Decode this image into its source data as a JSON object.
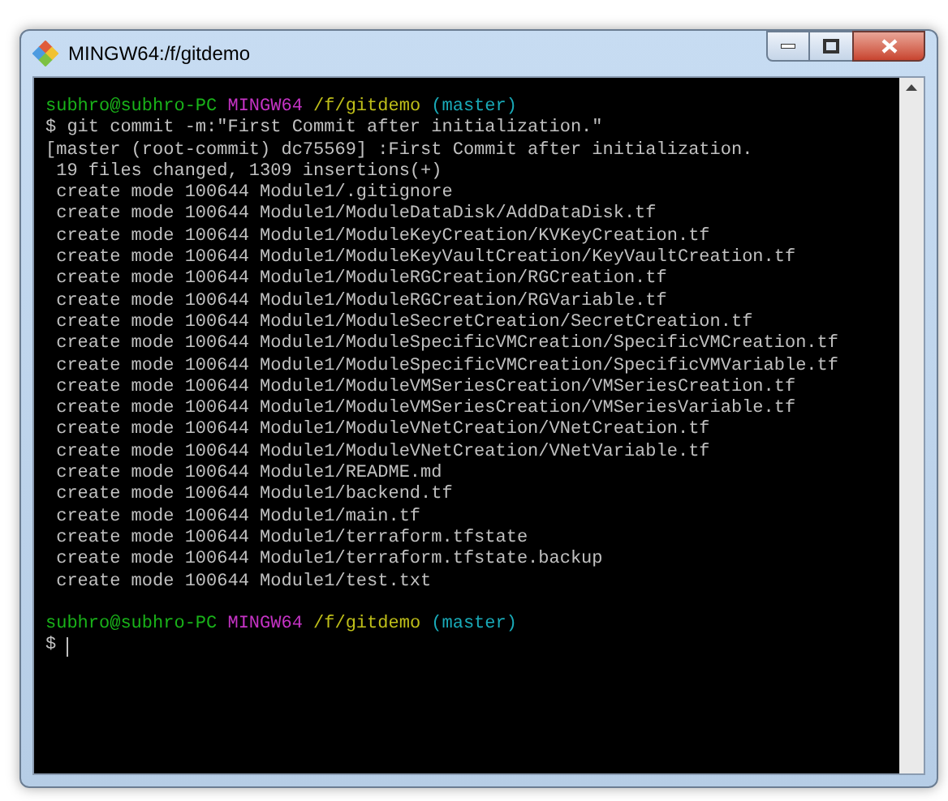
{
  "window": {
    "title": "MINGW64:/f/gitdemo"
  },
  "terminal": {
    "lines": [
      {
        "kind": "prompt",
        "user": "subhro@subhro-PC",
        "system": "MINGW64",
        "path": "/f/gitdemo",
        "branch": "(master)"
      },
      {
        "kind": "text",
        "text": "$ git commit -m:\"First Commit after initialization.\""
      },
      {
        "kind": "text",
        "text": "[master (root-commit) dc75569] :First Commit after initialization."
      },
      {
        "kind": "text",
        "text": " 19 files changed, 1309 insertions(+)"
      },
      {
        "kind": "text",
        "text": " create mode 100644 Module1/.gitignore"
      },
      {
        "kind": "text",
        "text": " create mode 100644 Module1/ModuleDataDisk/AddDataDisk.tf"
      },
      {
        "kind": "text",
        "text": " create mode 100644 Module1/ModuleKeyCreation/KVKeyCreation.tf"
      },
      {
        "kind": "text",
        "text": " create mode 100644 Module1/ModuleKeyVaultCreation/KeyVaultCreation.tf"
      },
      {
        "kind": "text",
        "text": " create mode 100644 Module1/ModuleRGCreation/RGCreation.tf"
      },
      {
        "kind": "text",
        "text": " create mode 100644 Module1/ModuleRGCreation/RGVariable.tf"
      },
      {
        "kind": "text",
        "text": " create mode 100644 Module1/ModuleSecretCreation/SecretCreation.tf"
      },
      {
        "kind": "text",
        "text": " create mode 100644 Module1/ModuleSpecificVMCreation/SpecificVMCreation.tf"
      },
      {
        "kind": "text",
        "text": " create mode 100644 Module1/ModuleSpecificVMCreation/SpecificVMVariable.tf"
      },
      {
        "kind": "text",
        "text": " create mode 100644 Module1/ModuleVMSeriesCreation/VMSeriesCreation.tf"
      },
      {
        "kind": "text",
        "text": " create mode 100644 Module1/ModuleVMSeriesCreation/VMSeriesVariable.tf"
      },
      {
        "kind": "text",
        "text": " create mode 100644 Module1/ModuleVNetCreation/VNetCreation.tf"
      },
      {
        "kind": "text",
        "text": " create mode 100644 Module1/ModuleVNetCreation/VNetVariable.tf"
      },
      {
        "kind": "text",
        "text": " create mode 100644 Module1/README.md"
      },
      {
        "kind": "text",
        "text": " create mode 100644 Module1/backend.tf"
      },
      {
        "kind": "text",
        "text": " create mode 100644 Module1/main.tf"
      },
      {
        "kind": "text",
        "text": " create mode 100644 Module1/terraform.tfstate"
      },
      {
        "kind": "text",
        "text": " create mode 100644 Module1/terraform.tfstate.backup"
      },
      {
        "kind": "text",
        "text": " create mode 100644 Module1/test.txt"
      },
      {
        "kind": "blank"
      },
      {
        "kind": "prompt",
        "user": "subhro@subhro-PC",
        "system": "MINGW64",
        "path": "/f/gitdemo",
        "branch": "(master)"
      },
      {
        "kind": "input",
        "text": "$"
      }
    ]
  }
}
